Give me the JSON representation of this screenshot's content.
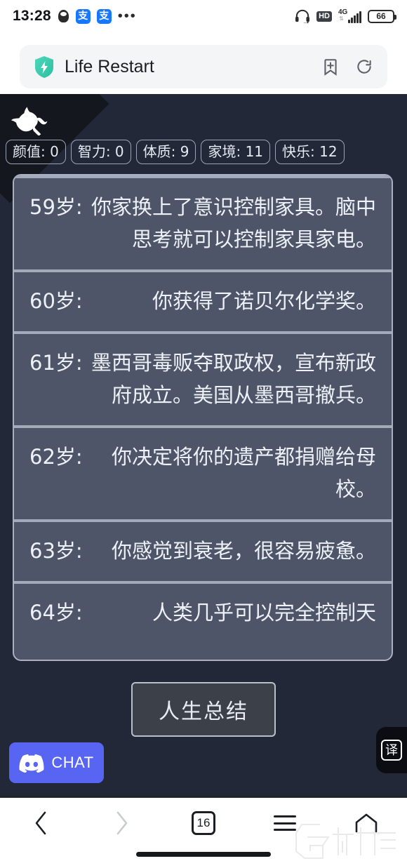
{
  "status_bar": {
    "time": "13:28",
    "icons_left": [
      "qq-icon",
      "alipay-icon",
      "alipay-icon",
      "overflow-dots-icon"
    ],
    "alipay_glyph": "支",
    "hd_label": "HD",
    "network_label": "4G",
    "battery_level": "66",
    "icons_right": [
      "headset-icon",
      "hd-badge",
      "signal-icon",
      "battery-icon"
    ]
  },
  "browser": {
    "title": "Life Restart",
    "site_icon": "shield-bolt-icon",
    "bookmark_icon": "bookmark-add-icon",
    "refresh_icon": "refresh-icon"
  },
  "game": {
    "corner_ribbon_icon": "github-octocat-icon",
    "stats": [
      {
        "label": "颜值",
        "value": "0",
        "display": "颜值: 0"
      },
      {
        "label": "智力",
        "value": "0",
        "display": "智力: 0"
      },
      {
        "label": "体质",
        "value": "9",
        "display": "体质: 9"
      },
      {
        "label": "家境",
        "value": "11",
        "display": "家境: 11"
      },
      {
        "label": "快乐",
        "value": "12",
        "display": "快乐: 12"
      }
    ],
    "events": [
      {
        "age": "59岁:",
        "text": "你家换上了意识控制家具。脑中思考就可以控制家具家电。"
      },
      {
        "age": "60岁:",
        "text": "你获得了诺贝尔化学奖。"
      },
      {
        "age": "61岁:",
        "text": "墨西哥毒贩夺取政权，宣布新政府成立。美国从墨西哥撤兵。"
      },
      {
        "age": "62岁:",
        "text": "你决定将你的遗产都捐赠给母校。"
      },
      {
        "age": "63岁:",
        "text": "你感觉到衰老，很容易疲惫。"
      },
      {
        "age": "64岁:",
        "text": "人类几乎可以完全控制天"
      }
    ],
    "summary_button": "人生总结",
    "discord_button": "CHAT",
    "discord_icon": "discord-icon",
    "translate_button": "译",
    "colors": {
      "background": "#232838",
      "panel": "#4e5568",
      "panel_border": "#a9b1c1",
      "discord": "#5865f2",
      "text": "#eef1f7"
    }
  },
  "bottom_nav": {
    "back_icon": "chevron-left-icon",
    "forward_icon": "chevron-right-icon",
    "tab_count": "16",
    "menu_icon": "hamburger-menu-icon",
    "home_icon": "home-icon",
    "watermark": "九游"
  }
}
